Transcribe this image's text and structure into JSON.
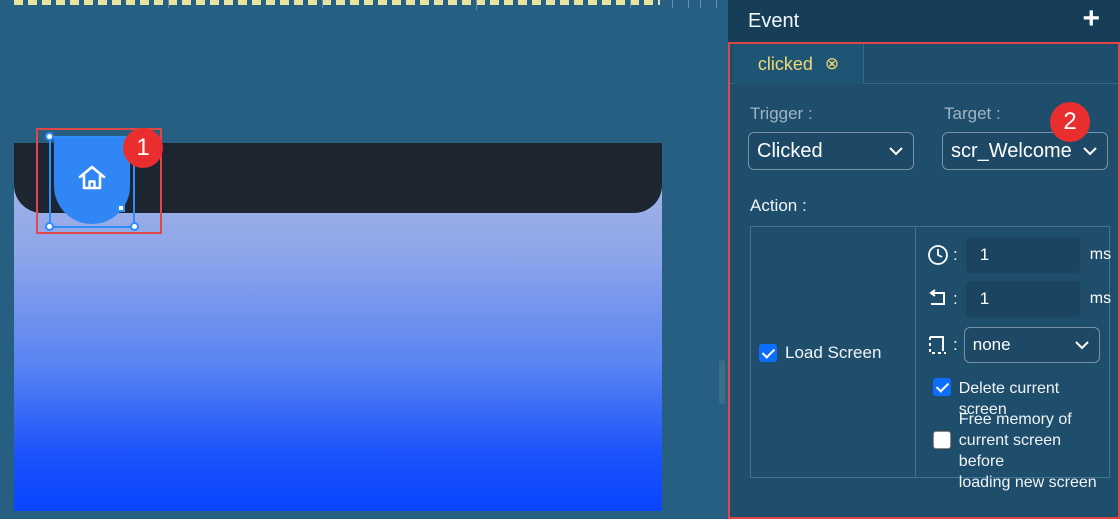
{
  "panel": {
    "title": "Event",
    "add_symbol": "+"
  },
  "tabs": [
    {
      "label": "clicked",
      "close_symbol": "⊗"
    }
  ],
  "trigger": {
    "label": "Trigger :",
    "value": "Clicked"
  },
  "target": {
    "label": "Target :",
    "value": "scr_Welcome"
  },
  "action": {
    "label": "Action :",
    "load_screen": {
      "label": "Load Screen",
      "checked": true
    },
    "delay": {
      "icon": "clock-icon",
      "colon": ":",
      "value": "1",
      "unit": "ms"
    },
    "time": {
      "icon": "return-arrow-icon",
      "colon": ":",
      "value": "1",
      "unit": "ms"
    },
    "animation": {
      "icon": "dashed-frame-icon",
      "colon": ":",
      "value": "none"
    },
    "delete_current": {
      "label": "Delete current screen",
      "checked": true
    },
    "free_memory": {
      "label_lines": [
        "Free memory of",
        "current screen before",
        "loading new screen"
      ],
      "checked": false
    }
  },
  "badges": {
    "one": "1",
    "two": "2"
  },
  "colors": {
    "canvas_bg": "#265f81",
    "panel_bg": "#1f4d6b",
    "highlight_red": "#e04848",
    "tab_text": "#f0d873",
    "home_button": "#2f86f4",
    "checkbox": "#0d6efd"
  },
  "canvas": {
    "home_button_icon": "home-icon"
  }
}
